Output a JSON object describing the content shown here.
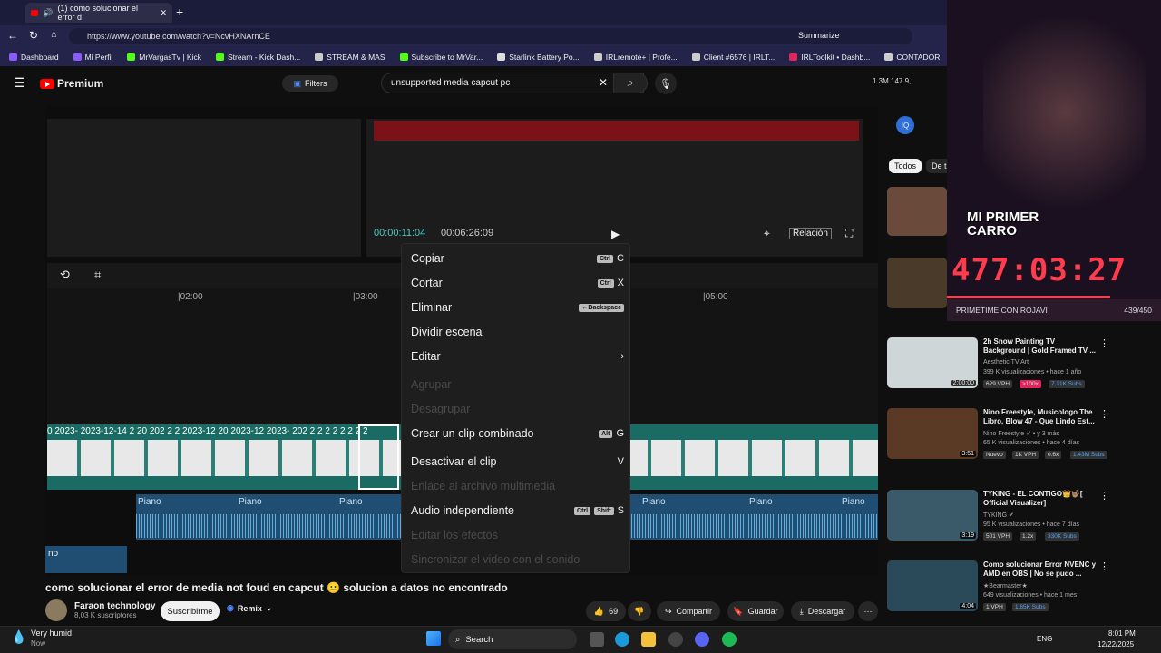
{
  "browser": {
    "tab_title": "(1) como solucionar el error d",
    "url": "https://www.youtube.com/watch?v=NcvHXNArnCE",
    "summarize": "Summarize",
    "bookmarks": [
      "Dashboard",
      "Mi Perfil",
      "MrVargasTv | Kick",
      "Stream - Kick Dash...",
      "STREAM & MAS",
      "Subscribe to MrVar...",
      "Starlink Battery Po...",
      "IRLremote+ | Profe...",
      "Client #6576 | IRLT...",
      "IRLToolkit • Dashb...",
      "CONTADOR"
    ]
  },
  "youtube": {
    "logo": "Premium",
    "filters": "Filters",
    "search_value": "unsupported media capcut pc",
    "stats": "1.3M  147  9,",
    "tabs": [
      "Todos",
      "De t"
    ]
  },
  "editor": {
    "time_current": "00:00:11:04",
    "time_total": "00:06:26:09",
    "ratio_btn": "Relación",
    "ruler": [
      "|02:00",
      "|03:00",
      "|05:00"
    ],
    "track_labels": "0  2023-  2023-12-14 2  20 202 2  2  2023-12 20  2023-12  2023-  202  2  2  2  2  2  2  2  2",
    "audio_label": "Piano",
    "audio2_label": "no"
  },
  "context_menu": [
    {
      "label": "Copiar",
      "keys": [
        "Ctrl"
      ],
      "letter": "C",
      "disabled": false
    },
    {
      "label": "Cortar",
      "keys": [
        "Ctrl"
      ],
      "letter": "X",
      "disabled": false
    },
    {
      "label": "Eliminar",
      "keys": [
        "←Backspace"
      ],
      "letter": "",
      "disabled": false
    },
    {
      "label": "Dividir escena",
      "keys": [],
      "letter": "",
      "disabled": false
    },
    {
      "label": "Editar",
      "keys": [],
      "letter": "›",
      "disabled": false
    },
    {
      "label": "Agrupar",
      "keys": [],
      "letter": "",
      "disabled": true
    },
    {
      "label": "Desagrupar",
      "keys": [],
      "letter": "",
      "disabled": true
    },
    {
      "label": "Crear un clip combinado",
      "keys": [
        "Alt"
      ],
      "letter": "G",
      "disabled": false
    },
    {
      "label": "Desactivar el clip",
      "keys": [],
      "letter": "V",
      "disabled": false
    },
    {
      "label": "Enlace al archivo multimedia",
      "keys": [],
      "letter": "",
      "disabled": true
    },
    {
      "label": "Audio independiente",
      "keys": [
        "Ctrl",
        "Shift"
      ],
      "letter": "S",
      "disabled": false
    },
    {
      "label": "Editar los efectos",
      "keys": [],
      "letter": "",
      "disabled": true
    },
    {
      "label": "Sincronizar el video con el sonido",
      "keys": [],
      "letter": "",
      "disabled": true
    }
  ],
  "video": {
    "title": "como solucionar el error de media not foud en capcut 😐 solucion a datos no encontrado",
    "channel": "Faraon technology",
    "subscribers": "8,03 K suscriptores",
    "subscribe": "Suscribirme",
    "remix": "Remix",
    "likes": "69",
    "share": "Compartir",
    "save": "Guardar",
    "download": "Descargar"
  },
  "stream": {
    "overlay_text": "MI PRIMER CARRO",
    "timer": "477:03:27",
    "label": "PRIMETIME CON ROJAVI",
    "count": "439/450"
  },
  "recommendations": [
    {
      "title": "2h Snow Painting TV Background | Gold Framed TV ...",
      "channel": "Aesthetic TV Art",
      "meta": "399 K visualizaciones • hace 1 año",
      "duration": "2:00:00",
      "badges": [
        "629 VPH",
        ">100x",
        "7.21K Subs"
      ],
      "color": "#cfd6d8"
    },
    {
      "title": "Nino Freestyle, Musicologo The Libro, Blow 47 - Que Lindo Est...",
      "channel": "Nino Freestyle ✔ • y 3 más",
      "meta": "65 K visualizaciones • hace 4 días",
      "duration": "3:51",
      "badges": [
        "Nuevo",
        "1K VPH",
        "0.6x",
        "1.43M Subs"
      ],
      "color": "#5a3a25"
    },
    {
      "title": "TYKING - EL CONTIGO👑🤟🏽[ Official Visualizer]",
      "channel": "TYKING ✔",
      "meta": "95 K visualizaciones • hace 7 días",
      "duration": "3:19",
      "badges": [
        "501 VPH",
        "1.2x",
        "330K Subs"
      ],
      "color": "#3a5a6a"
    },
    {
      "title": "Como solucionar Error NVENC y AMD en OBS | No se pudo ...",
      "channel": "★Bearmaster★",
      "meta": "649 visualizaciones • hace 1 mes",
      "duration": "4:04",
      "badges": [
        "1 VPH",
        "1.65K Subs"
      ],
      "color": "#2a4a5a"
    }
  ],
  "taskbar": {
    "weather": "Very humid",
    "weather_sub": "Now",
    "search": "Search",
    "lang": "ENG",
    "time": "8:01 PM",
    "date": "12/22/2025"
  }
}
